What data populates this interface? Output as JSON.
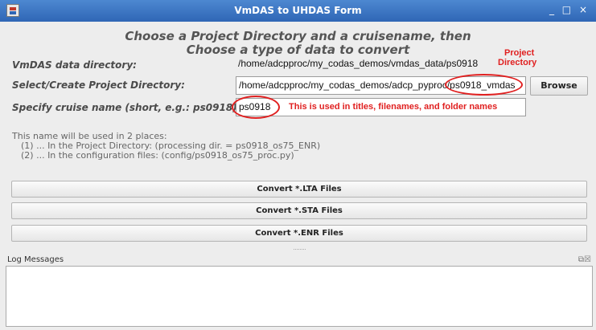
{
  "window": {
    "title": "VmDAS to UHDAS Form",
    "minimize_label": "_",
    "maximize_label": "□",
    "close_label": "×"
  },
  "heading": {
    "line1": "Choose a Project Directory and a cruisename, then",
    "line2": "Choose a type of data to convert"
  },
  "vmdas": {
    "label": "VmDAS data directory:",
    "value": "/home/adcpproc/my_codas_demos/vmdas_data/ps0918"
  },
  "annotations": {
    "project_dir_line1": "Project",
    "project_dir_line2": "Directory",
    "cruise_note": "This is used in titles, filenames, and folder names"
  },
  "project": {
    "label": "Select/Create Project Directory:",
    "value": "/home/adcpproc/my_codas_demos/adcp_pyproc/ps0918_vmdas",
    "browse_label": "Browse"
  },
  "cruise": {
    "label": "Specify cruise name (short, e.g.: ps0918):",
    "value": "ps0918"
  },
  "info": {
    "line1": "This name will be used in 2 places:",
    "line2": "(1) ... In the Project Directory: (processing dir. = ps0918_os75_ENR)",
    "line3": "(2) ... In the configuration files: (config/ps0918_os75_proc.py)"
  },
  "buttons": {
    "lta": "Convert *.LTA Files",
    "sta": "Convert *.STA Files",
    "enr": "Convert *.ENR Files"
  },
  "log": {
    "title": "Log Messages"
  }
}
